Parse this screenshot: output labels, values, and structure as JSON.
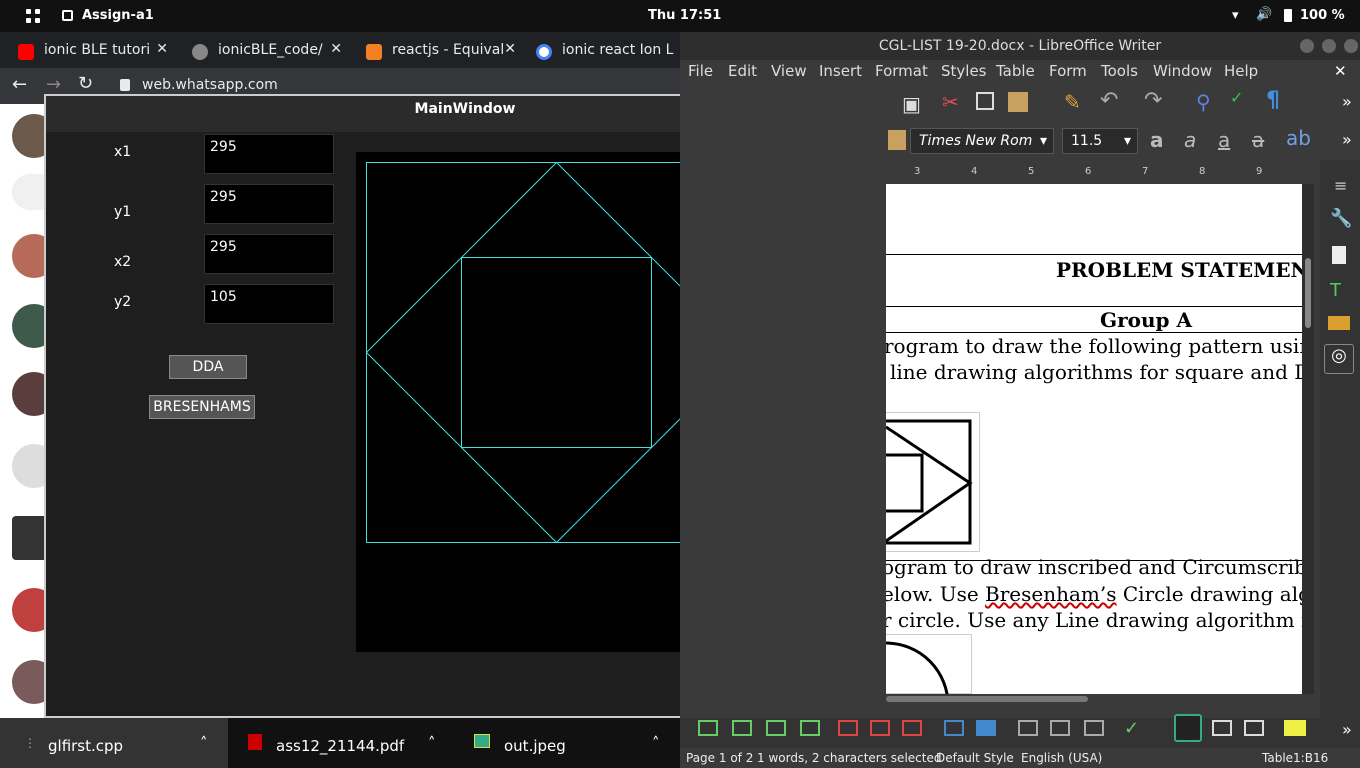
{
  "topbar": {
    "app_name": "Assign-a1",
    "clock": "Thu 17:51",
    "battery": "100 %"
  },
  "browser": {
    "tabs": [
      {
        "label": "ionic BLE tutori",
        "favicon": "youtube-icon",
        "color": "#ff0000"
      },
      {
        "label": "ionicBLE_code/",
        "favicon": "github-icon",
        "color": "#888888"
      },
      {
        "label": "reactjs - Equival",
        "favicon": "stackoverflow-icon",
        "color": "#f48024"
      },
      {
        "label": "ionic react Ion L",
        "favicon": "google-icon",
        "color": "#4285f4"
      }
    ],
    "url": "web.whatsapp.com"
  },
  "mainwindow": {
    "title": "MainWindow",
    "fields": [
      {
        "label": "x1",
        "value": "295"
      },
      {
        "label": "y1",
        "value": "295"
      },
      {
        "label": "x2",
        "value": "295"
      },
      {
        "label": "y2",
        "value": "105"
      }
    ],
    "buttons": {
      "dda": "DDA",
      "bresenham": "BRESENHAMS"
    },
    "line_color": "#40e0e0"
  },
  "writer": {
    "title": "CGL-LIST 19-20.docx - LibreOffice Writer",
    "menu": [
      "File",
      "Edit",
      "View",
      "Insert",
      "Format",
      "Styles",
      "Table",
      "Form",
      "Tools",
      "Window",
      "Help"
    ],
    "font_name": "Times New Rom",
    "font_size": "11.5",
    "ruler_ticks": [
      "3",
      "4",
      "5",
      "6",
      "7",
      "8",
      "9"
    ],
    "doc": {
      "heading": "PROBLEM STATEMENT",
      "group": "Group A",
      "p1_line1": "rogram to draw the following pattern using",
      "p1_line2": "line drawing algorithms for square and D",
      "p2_line1": "ogram to draw inscribed and Circumscribed",
      "p2_line2_a": "elow. Use ",
      "p2_line2_b": "Bresenham’s",
      "p2_line2_c": " Circle drawing algo",
      "p2_line3": "r circle. Use any Line drawing algorithm for"
    },
    "status": {
      "page": "Page 1 of 2",
      "selection": "1 words, 2 characters selected",
      "style": "Default Style",
      "language": "English (USA)",
      "cell": "Table1:B16"
    }
  },
  "taskbar": {
    "items": [
      {
        "label": "glfirst.cpp",
        "icon": "code-file-icon"
      },
      {
        "label": "ass12_21144.pdf",
        "icon": "pdf-icon"
      },
      {
        "label": "out.jpeg",
        "icon": "image-icon"
      }
    ]
  }
}
